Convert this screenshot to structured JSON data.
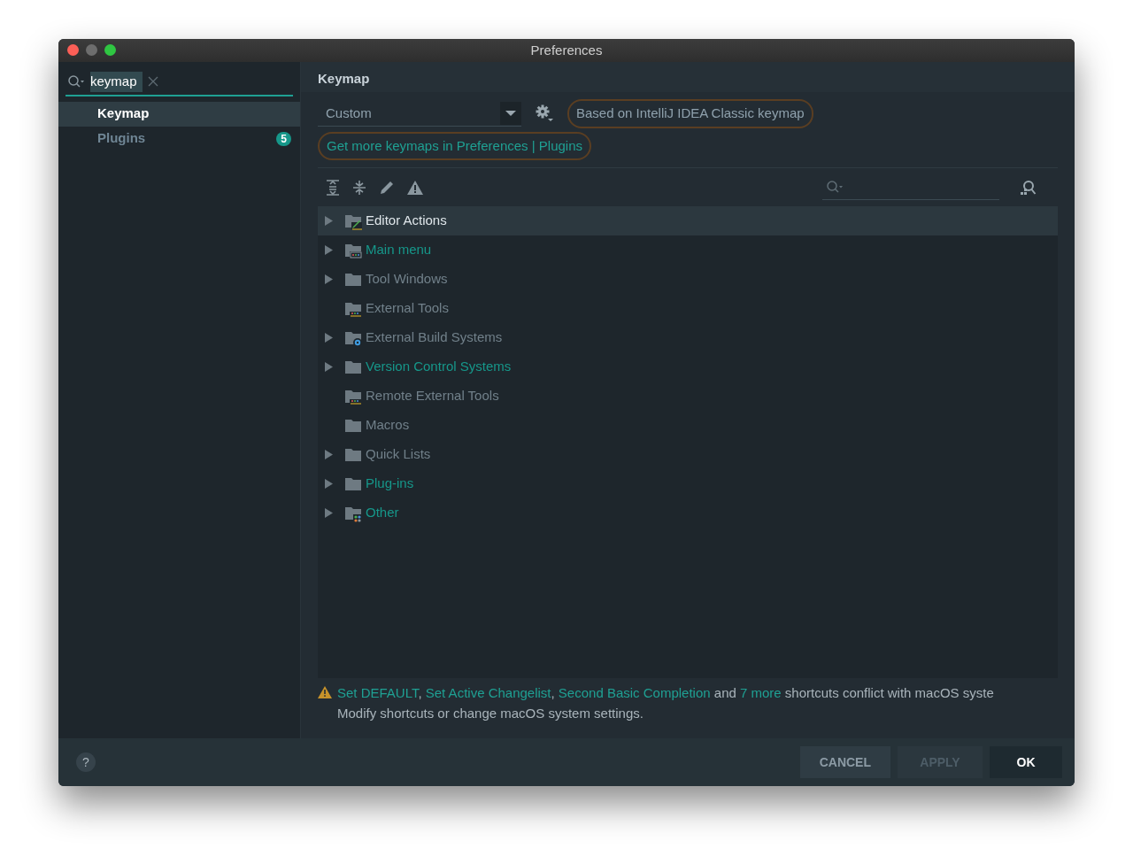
{
  "window": {
    "title": "Preferences"
  },
  "search": {
    "value": "keymap",
    "text_selected": true
  },
  "sidebar": {
    "items": [
      {
        "label": "Keymap",
        "selected": true
      },
      {
        "label": "Plugins",
        "selected": false,
        "badge": "5"
      }
    ]
  },
  "page_title": "Keymap",
  "keymap_select": {
    "value": "Custom"
  },
  "based_on": "Based on IntelliJ IDEA Classic keymap",
  "more_link": "Get more keymaps in Preferences | Plugins",
  "tree": [
    {
      "label": "Editor Actions",
      "kind": "edit",
      "expandable": true,
      "modified": false,
      "selected": true
    },
    {
      "label": "Main menu",
      "kind": "menu",
      "expandable": true,
      "modified": true,
      "selected": false
    },
    {
      "label": "Tool Windows",
      "kind": "plain",
      "expandable": true,
      "modified": false,
      "selected": false
    },
    {
      "label": "External Tools",
      "kind": "tools",
      "expandable": false,
      "modified": false,
      "selected": false
    },
    {
      "label": "External Build Systems",
      "kind": "gear",
      "expandable": true,
      "modified": false,
      "selected": false
    },
    {
      "label": "Version Control Systems",
      "kind": "plain",
      "expandable": true,
      "modified": true,
      "selected": false
    },
    {
      "label": "Remote External Tools",
      "kind": "tools",
      "expandable": false,
      "modified": false,
      "selected": false
    },
    {
      "label": "Macros",
      "kind": "plain",
      "expandable": false,
      "modified": false,
      "selected": false
    },
    {
      "label": "Quick Lists",
      "kind": "plain",
      "expandable": true,
      "modified": false,
      "selected": false
    },
    {
      "label": "Plug-ins",
      "kind": "plain",
      "expandable": true,
      "modified": true,
      "selected": false
    },
    {
      "label": "Other",
      "kind": "other",
      "expandable": true,
      "modified": true,
      "selected": false
    }
  ],
  "warning": {
    "parts": [
      {
        "text": "Set DEFAULT",
        "link": true
      },
      {
        "text": ", ",
        "link": false
      },
      {
        "text": "Set Active Changelist",
        "link": true
      },
      {
        "text": ", ",
        "link": false
      },
      {
        "text": "Second Basic Completion",
        "link": true
      },
      {
        "text": " and ",
        "link": false
      },
      {
        "text": "7 more",
        "link": true
      },
      {
        "text": " shortcuts conflict with macOS syste",
        "link": false
      }
    ],
    "note": "Modify shortcuts or change macOS system settings."
  },
  "buttons": [
    {
      "label": "CANCEL",
      "kind": "normal",
      "disabled": false
    },
    {
      "label": "APPLY",
      "kind": "normal",
      "disabled": true
    },
    {
      "label": "OK",
      "kind": "default",
      "disabled": false
    }
  ],
  "help": "?"
}
